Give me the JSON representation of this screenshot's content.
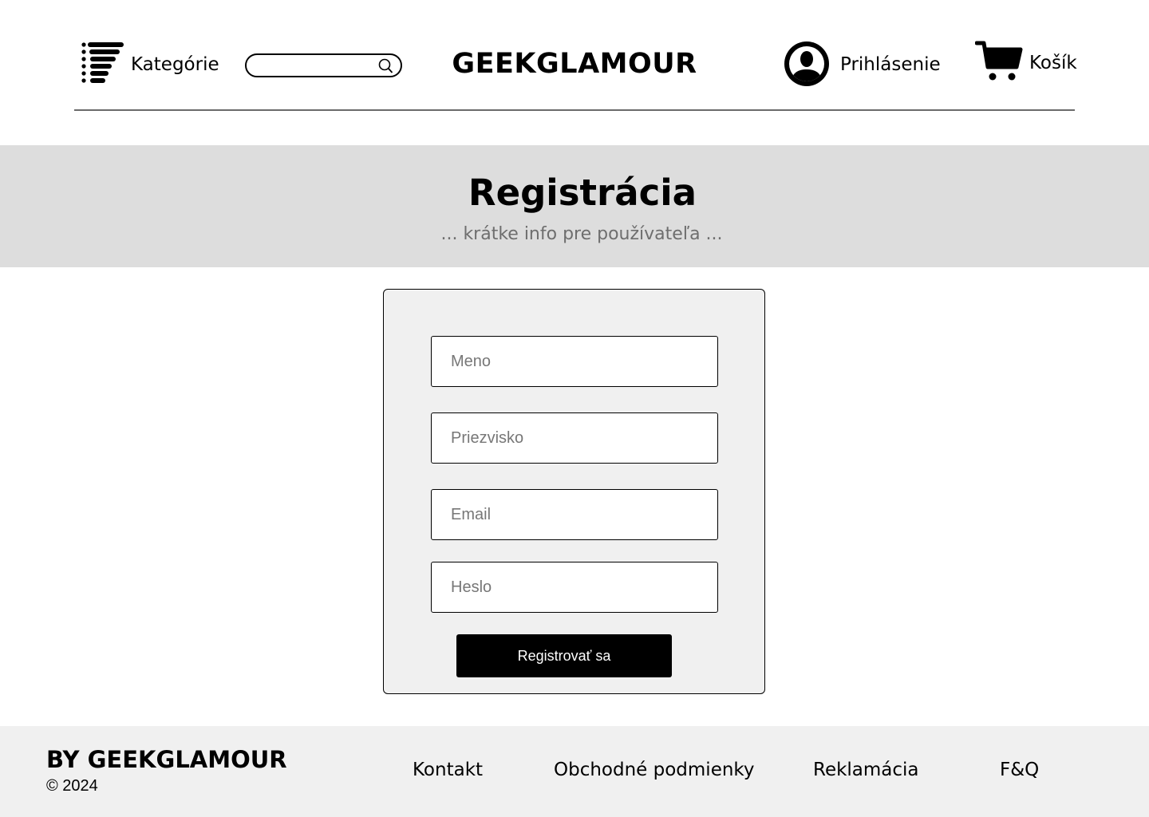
{
  "header": {
    "categories_label": "Kategórie",
    "categories_icon": "list-menu-icon",
    "search": {
      "value": "",
      "placeholder": "",
      "icon": "search-icon"
    },
    "logo": "GEEKGLAMOUR",
    "login_label": "Prihlásenie",
    "login_icon": "user-avatar-icon",
    "cart_label": "Košík",
    "cart_icon": "shopping-cart-icon"
  },
  "hero": {
    "title": "Registrácia",
    "subtitle": "... krátke info pre používateľa ..."
  },
  "form": {
    "fields": [
      {
        "placeholder": "Meno",
        "value": ""
      },
      {
        "placeholder": "Priezvisko",
        "value": ""
      },
      {
        "placeholder": "Email",
        "value": ""
      },
      {
        "placeholder": "Heslo",
        "value": ""
      }
    ],
    "submit_label": "Registrovať sa"
  },
  "footer": {
    "brand": "BY GEEKGLAMOUR",
    "copyright": "© 2024",
    "links": [
      "Kontakt",
      "Obchodné podmienky",
      "Reklamácia",
      "F&Q"
    ]
  },
  "colors": {
    "hero_background": "#dddddd",
    "card_background": "#f0f0f0",
    "footer_background": "#f0f0f0",
    "button_background": "#000000",
    "subtitle_text": "#6e6e6e"
  }
}
